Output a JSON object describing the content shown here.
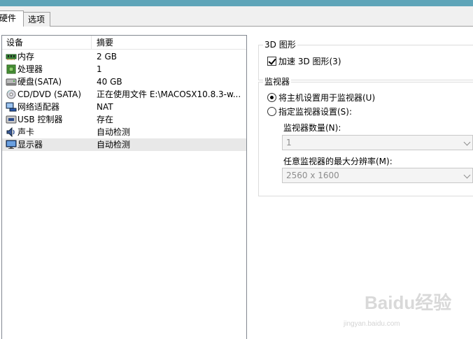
{
  "tabs": [
    {
      "label": "硬件",
      "active": true
    },
    {
      "label": "选项",
      "active": false
    }
  ],
  "device_list": {
    "columns": [
      "设备",
      "摘要"
    ],
    "rows": [
      {
        "icon": "memory-icon",
        "name": "内存",
        "summary": "2 GB"
      },
      {
        "icon": "processor-icon",
        "name": "处理器",
        "summary": "1"
      },
      {
        "icon": "harddisk-icon",
        "name": "硬盘(SATA)",
        "summary": "40 GB"
      },
      {
        "icon": "cd-dvd-icon",
        "name": "CD/DVD (SATA)",
        "summary": "正在使用文件 E:\\MACOSX10.8.3-w..."
      },
      {
        "icon": "network-adapter-icon",
        "name": "网络适配器",
        "summary": "NAT"
      },
      {
        "icon": "usb-controller-icon",
        "name": "USB 控制器",
        "summary": "存在"
      },
      {
        "icon": "sound-card-icon",
        "name": "声卡",
        "summary": "自动检测"
      },
      {
        "icon": "display-icon",
        "name": "显示器",
        "summary": "自动检测",
        "selected": true
      }
    ]
  },
  "graphics_3d": {
    "title": "3D 图形",
    "accelerate_label": "加速 3D 图形(3)",
    "accelerate_checked": true
  },
  "monitor": {
    "title": "监视器",
    "option_host_label": "将主机设置用于监视器(U)",
    "option_specify_label": "指定监视器设置(S):",
    "selected_option": "host",
    "count_label": "监视器数量(N):",
    "count_value": "1",
    "resolution_label": "任意监视器的最大分辨率(M):",
    "resolution_value": "2560 x 1600"
  },
  "watermark": {
    "logo_text": "Baidu经验",
    "url_text": "jingyan.baidu.com"
  },
  "colors": {
    "title_strip": "#5ea4b8",
    "selected_row": "#e8e8e8"
  }
}
